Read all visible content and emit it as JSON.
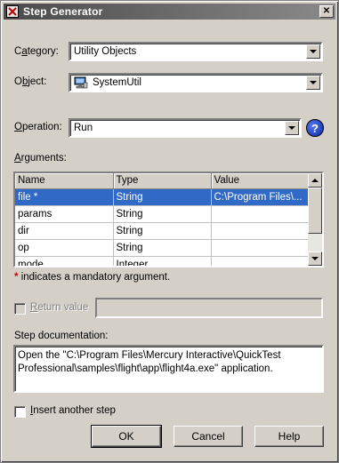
{
  "window": {
    "title": "Step Generator",
    "close_label": "✕"
  },
  "category": {
    "label_pre": "C",
    "label_under": "a",
    "label_post": "tegory:",
    "value": "Utility Objects"
  },
  "object": {
    "label_pre": "O",
    "label_under": "b",
    "label_post": "ject:",
    "value": "SystemUtil",
    "icon": "system-util-icon"
  },
  "operation": {
    "label_under": "O",
    "label_post": "peration:",
    "value": "Run",
    "help_label": "?"
  },
  "arguments": {
    "label_under": "A",
    "label_post": "rguments:",
    "columns": [
      "Name",
      "Type",
      "Value"
    ],
    "rows": [
      {
        "name": "file *",
        "type": "String",
        "value": "C:\\Program Files\\..."
      },
      {
        "name": "params",
        "type": "String",
        "value": ""
      },
      {
        "name": "dir",
        "type": "String",
        "value": ""
      },
      {
        "name": "op",
        "type": "String",
        "value": ""
      },
      {
        "name": "mode",
        "type": "Integer",
        "value": ""
      }
    ],
    "mandatory_star": "*",
    "mandatory_note": "indicates a mandatory argument."
  },
  "return_value": {
    "label_under": "R",
    "label_post": "eturn value"
  },
  "step_documentation": {
    "label": "Step documentation:",
    "line1": "Open the \"C:\\Program Files\\Mercury Interactive\\QuickTest",
    "line2": "Professional\\samples\\flight\\app\\flight4a.exe\" application."
  },
  "insert_another": {
    "label_under": "I",
    "label_post": "nsert another step"
  },
  "buttons": {
    "ok": "OK",
    "cancel": "Cancel",
    "help": "Help"
  },
  "colors": {
    "selection": "#3169c6",
    "dialog_bg": "#d4d0c8",
    "mandatory_star": "#d40000"
  }
}
